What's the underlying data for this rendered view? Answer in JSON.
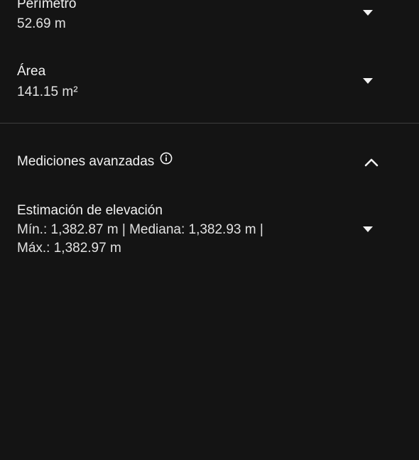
{
  "measurements": {
    "perimeter": {
      "label": "Perímetro",
      "value": "52.69 m",
      "icon": "chevron-down-icon"
    },
    "area": {
      "label": "Área",
      "value": "141.15 m²",
      "icon": "chevron-down-icon"
    }
  },
  "advanced": {
    "title": "Mediciones avanzadas",
    "info_icon": "info-icon",
    "toggle_icon": "chevron-up-icon",
    "elevation": {
      "label": "Estimación de elevación",
      "line1": "Mín.: 1,382.87 m | Mediana: 1,382.93 m |",
      "line2": "Máx.: 1,382.97 m",
      "icon": "chevron-down-icon"
    }
  },
  "colors": {
    "background": "#141414",
    "text": "#f2f2f2",
    "divider": "#3d3d3d"
  }
}
